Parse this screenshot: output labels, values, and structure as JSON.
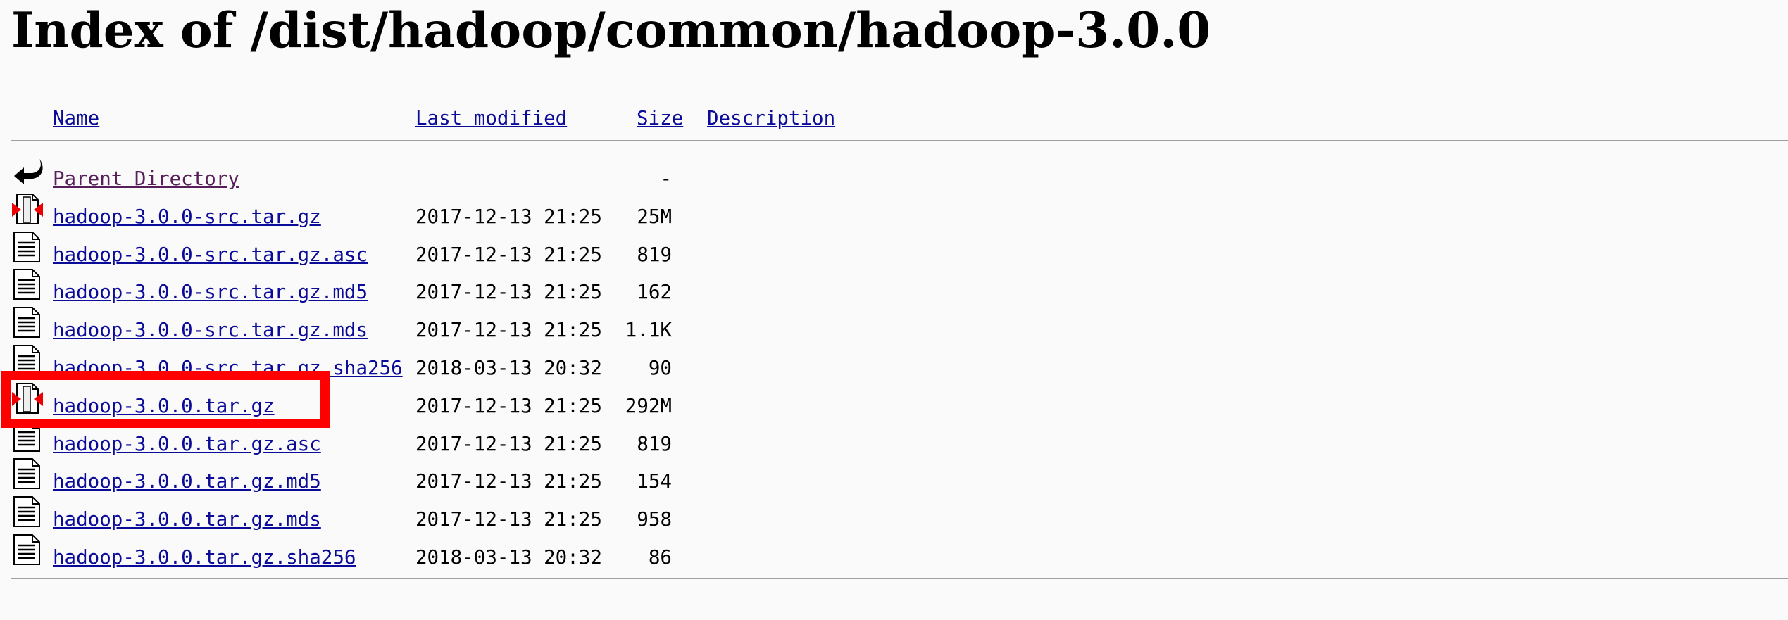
{
  "page": {
    "title": "Index of /dist/hadoop/common/hadoop-3.0.0"
  },
  "columns": {
    "name": "Name",
    "last_modified": "Last modified",
    "size": "Size",
    "description": "Description"
  },
  "rows": [
    {
      "icon": "back-icon",
      "name": "Parent Directory",
      "date": "",
      "size": "-"
    },
    {
      "icon": "compressed-file-icon",
      "name": "hadoop-3.0.0-src.tar.gz",
      "date": "2017-12-13 21:25",
      "size": "25M"
    },
    {
      "icon": "text-file-icon",
      "name": "hadoop-3.0.0-src.tar.gz.asc",
      "date": "2017-12-13 21:25",
      "size": "819"
    },
    {
      "icon": "text-file-icon",
      "name": "hadoop-3.0.0-src.tar.gz.md5",
      "date": "2017-12-13 21:25",
      "size": "162"
    },
    {
      "icon": "text-file-icon",
      "name": "hadoop-3.0.0-src.tar.gz.mds",
      "date": "2017-12-13 21:25",
      "size": "1.1K"
    },
    {
      "icon": "text-file-icon",
      "name": "hadoop-3.0.0-src.tar.gz.sha256",
      "date": "2018-03-13 20:32",
      "size": "90"
    },
    {
      "icon": "compressed-file-icon",
      "name": "hadoop-3.0.0.tar.gz",
      "date": "2017-12-13 21:25",
      "size": "292M"
    },
    {
      "icon": "text-file-icon",
      "name": "hadoop-3.0.0.tar.gz.asc",
      "date": "2017-12-13 21:25",
      "size": "819"
    },
    {
      "icon": "text-file-icon",
      "name": "hadoop-3.0.0.tar.gz.md5",
      "date": "2017-12-13 21:25",
      "size": "154"
    },
    {
      "icon": "text-file-icon",
      "name": "hadoop-3.0.0.tar.gz.mds",
      "date": "2017-12-13 21:25",
      "size": "958"
    },
    {
      "icon": "text-file-icon",
      "name": "hadoop-3.0.0.tar.gz.sha256",
      "date": "2018-03-13 20:32",
      "size": "86"
    }
  ],
  "colors": {
    "link": "#0b0b9a",
    "visited_link": "#58205a",
    "highlight": "#ff0000",
    "background": "#fafafa"
  }
}
